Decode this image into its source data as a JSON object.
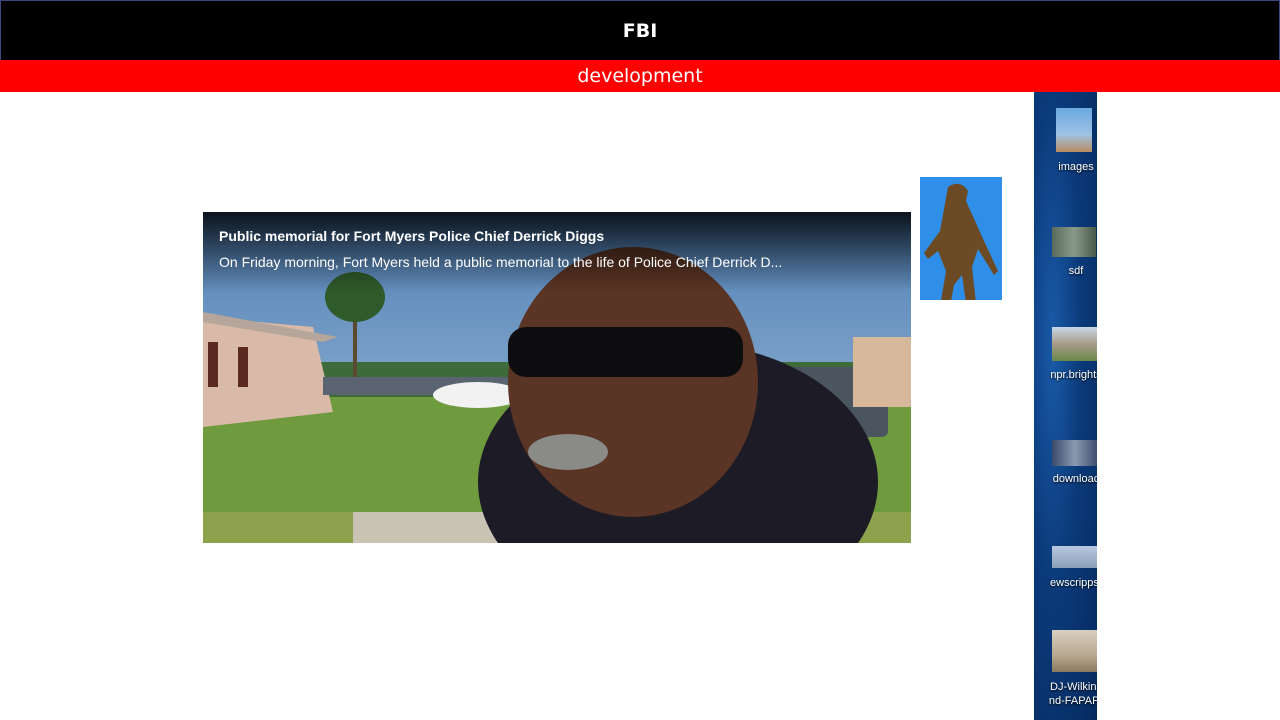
{
  "header": {
    "title": "FBI"
  },
  "banner": {
    "label": "development"
  },
  "video": {
    "title": "Public memorial for Fort Myers Police Chief Derrick Diggs",
    "description": "On Friday morning, Fort Myers held a public memorial to the life of Police Chief Derrick D..."
  },
  "desktop": {
    "icons": [
      {
        "label": "images",
        "icon": "image-file-icon"
      },
      {
        "label": "sdf",
        "icon": "image-file-icon"
      },
      {
        "label": "npr.brights",
        "icon": "image-file-icon"
      },
      {
        "label": "downloac",
        "icon": "image-file-icon"
      },
      {
        "label": "ewscripps.",
        "icon": "image-file-icon"
      },
      {
        "label_line1": "DJ-Wilkins",
        "label_line2": "nd-FAPAP-",
        "icon": "image-file-icon"
      }
    ]
  },
  "colors": {
    "header_bg": "#000000",
    "banner_bg": "#ff0000",
    "desktop_bg": "#0b3a7a"
  }
}
